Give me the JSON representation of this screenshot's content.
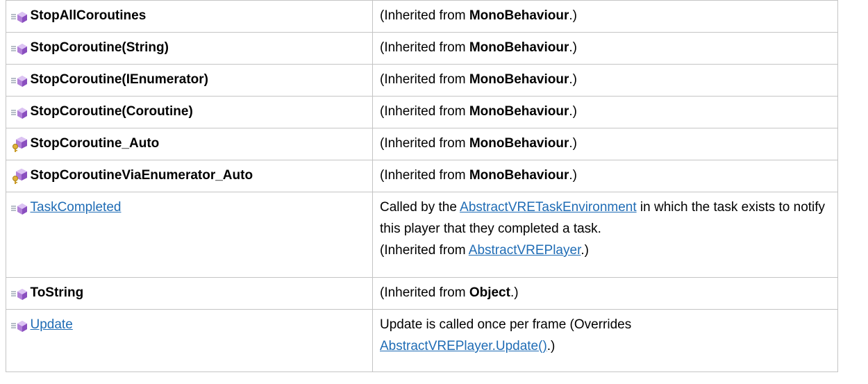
{
  "rows": [
    {
      "name": "StopAllCoroutines",
      "name_is_link": false,
      "icon": "public-method-icon",
      "desc_pre": "(Inherited from ",
      "desc_bold": "MonoBehaviour",
      "desc_post": ".)"
    },
    {
      "name": "StopCoroutine(String)",
      "name_is_link": false,
      "icon": "public-method-icon",
      "desc_pre": "(Inherited from ",
      "desc_bold": "MonoBehaviour",
      "desc_post": ".)"
    },
    {
      "name": "StopCoroutine(IEnumerator)",
      "name_is_link": false,
      "icon": "public-method-icon",
      "desc_pre": "(Inherited from ",
      "desc_bold": "MonoBehaviour",
      "desc_post": ".)"
    },
    {
      "name": "StopCoroutine(Coroutine)",
      "name_is_link": false,
      "icon": "public-method-icon",
      "desc_pre": "(Inherited from ",
      "desc_bold": "MonoBehaviour",
      "desc_post": ".)"
    },
    {
      "name": "StopCoroutine_Auto",
      "name_is_link": false,
      "icon": "internal-method-icon",
      "desc_pre": "(Inherited from ",
      "desc_bold": "MonoBehaviour",
      "desc_post": ".)"
    },
    {
      "name": "StopCoroutineViaEnumerator_Auto",
      "name_is_link": false,
      "icon": "internal-method-icon",
      "desc_pre": "(Inherited from ",
      "desc_bold": "MonoBehaviour",
      "desc_post": ".)"
    },
    {
      "name": "TaskCompleted",
      "name_is_link": true,
      "icon": "public-method-icon",
      "desc_line1_pre": "Called by the ",
      "desc_line1_link": "AbstractVRETaskEnvironment",
      "desc_line1_post": " in which the task exists to notify this player that they completed a task.",
      "desc_line2_pre": "(Inherited from ",
      "desc_line2_link": "AbstractVREPlayer",
      "desc_line2_post": ".)"
    },
    {
      "name": "ToString",
      "name_is_link": false,
      "icon": "public-method-icon",
      "desc_pre": "(Inherited from ",
      "desc_bold": "Object",
      "desc_post": ".)"
    },
    {
      "name": "Update",
      "name_is_link": true,
      "icon": "public-method-icon",
      "desc_line1_pre": "Update is called once per frame (Overrides ",
      "desc_line1_link": "AbstractVREPlayer.Update()",
      "desc_line1_post": ".)"
    }
  ],
  "colors": {
    "link": "#1F6CB5",
    "border": "#C4C4C4",
    "icon_purple": "#9B59C7",
    "icon_key": "#D4A62A"
  }
}
